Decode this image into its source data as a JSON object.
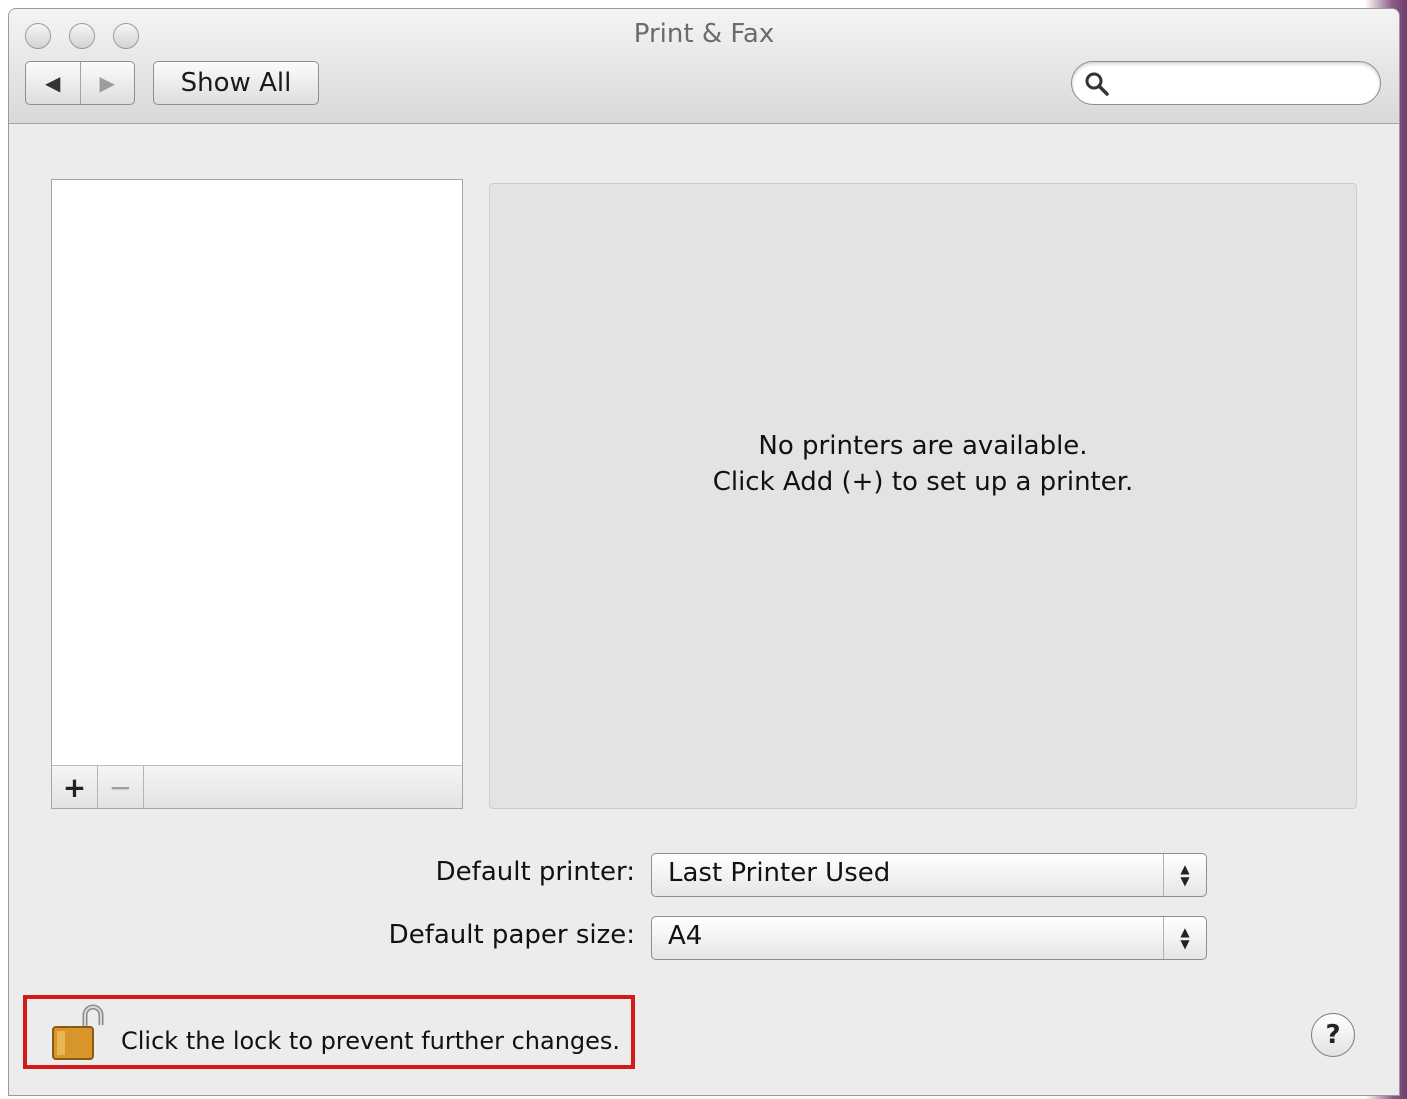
{
  "window": {
    "title": "Print & Fax"
  },
  "toolbar": {
    "back_icon": "◀",
    "forward_icon": "▶",
    "show_all_label": "Show All",
    "search_placeholder": "",
    "search_value": ""
  },
  "printer_list": {
    "add_label": "+",
    "remove_label": "−",
    "items": []
  },
  "detail": {
    "message_line1": "No printers are available.",
    "message_line2": "Click Add (+) to set up a printer."
  },
  "settings": {
    "default_printer_label": "Default printer:",
    "default_printer_value": "Last Printer Used",
    "default_paper_label": "Default paper size:",
    "default_paper_value": "A4"
  },
  "footer": {
    "lock_text": "Click the lock to prevent further changes.",
    "lock_state": "unlocked",
    "help_label": "?"
  },
  "colors": {
    "highlight_border": "#d21a1a",
    "window_bg": "#ececec",
    "detail_bg": "#e3e3e3"
  }
}
